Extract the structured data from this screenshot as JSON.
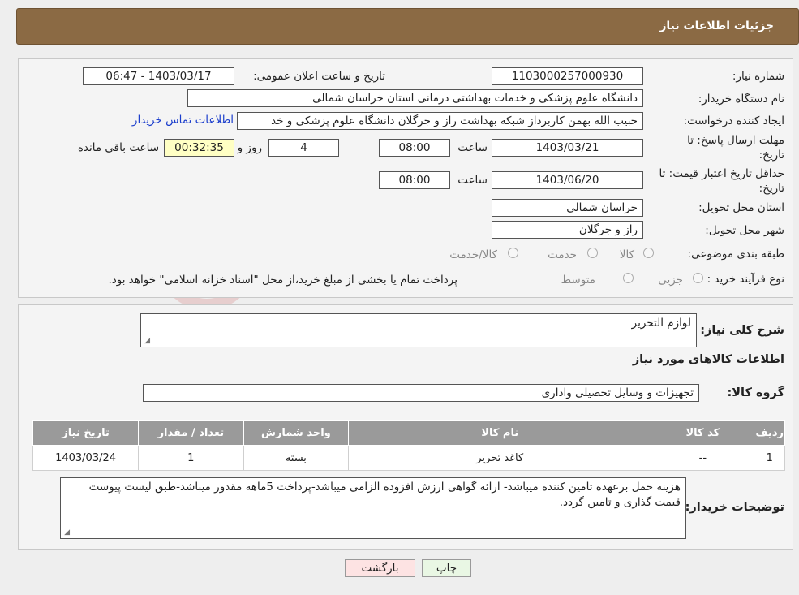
{
  "header": {
    "title": "جزئیات اطلاعات نیاز"
  },
  "form": {
    "need_number_label": "شماره نیاز:",
    "need_number": "1103000257000930",
    "announce_label": "تاریخ و ساعت اعلان عمومی:",
    "announce_value": "1403/03/17 - 06:47",
    "buyer_org_label": "نام دستگاه خریدار:",
    "buyer_org": "دانشگاه علوم پزشکی و خدمات بهداشتی درمانی استان خراسان شمالی",
    "requester_label": "ایجاد کننده درخواست:",
    "requester": "حبیب الله بهمن کاربرداز شبکه بهداشت راز و جرگلان دانشگاه علوم پزشکی و خد",
    "contact_link": "اطلاعات تماس خریدار",
    "deadline_label_line1": "مهلت ارسال پاسخ: تا",
    "deadline_label_line2": "تاریخ:",
    "deadline_date": "1403/03/21",
    "time_label": "ساعت",
    "deadline_time": "08:00",
    "days_value": "4",
    "days_label": "روز و",
    "remaining_value": "00:32:35",
    "remaining_label": "ساعت باقی مانده",
    "validity_label_line1": "حداقل تاریخ اعتبار قیمت: تا",
    "validity_label_line2": "تاریخ:",
    "validity_date": "1403/06/20",
    "validity_time": "08:00",
    "province_label": "استان محل تحویل:",
    "province": "خراسان شمالی",
    "city_label": "شهر محل تحویل:",
    "city": "راز و جرگلان",
    "category_label": "طبقه بندی موضوعی:",
    "category_options": [
      "کالا",
      "خدمت",
      "کالا/خدمت"
    ],
    "process_label": "نوع فرآیند خرید :",
    "process_options": [
      "جزیی",
      "متوسط"
    ],
    "process_note": "پرداخت تمام یا بخشی از مبلغ خرید،از محل \"اسناد خزانه اسلامی\" خواهد بود."
  },
  "details": {
    "summary_label": "شرح کلی نیاز:",
    "summary": "لوازم التحریر",
    "goods_info_title": "اطلاعات کالاهای مورد نیاز",
    "group_label": "گروه کالا:",
    "group": "تجهیزات و وسایل تحصیلی واداری",
    "table": {
      "headers": [
        "ردیف",
        "کد کالا",
        "نام کالا",
        "واحد شمارش",
        "تعداد / مقدار",
        "تاریخ نیاز"
      ],
      "rows": [
        [
          "1",
          "--",
          "کاغذ تحریر",
          "بسته",
          "1",
          "1403/03/24"
        ]
      ]
    },
    "buyer_notes_label": "توضیحات خریدار:",
    "buyer_notes": "هزینه حمل برعهده تامین کننده میباشد- ارائه گواهی ارزش افزوده الزامی میباشد-پرداخت 5ماهه مقدور میباشد-طبق لیست پیوست قیمت گذاری و تامین گردد."
  },
  "buttons": {
    "print": "چاپ",
    "back": "بازگشت"
  },
  "colors": {
    "header_bg": "#8b6a44",
    "remaining_bg": "#ffffc4",
    "back_bg": "#fde3e3",
    "print_bg": "#e9f7e4"
  }
}
